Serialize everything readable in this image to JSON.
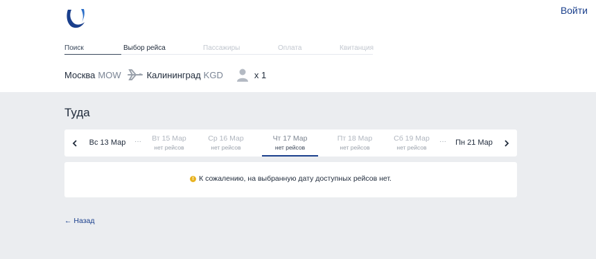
{
  "header": {
    "logo_icon": "utair-logo",
    "login_label": "Войти"
  },
  "steps": [
    {
      "label": "Поиск",
      "state": "done"
    },
    {
      "label": "Выбор рейса",
      "state": "active"
    },
    {
      "label": "Пассажиры",
      "state": "disabled"
    },
    {
      "label": "Оплата",
      "state": "disabled"
    },
    {
      "label": "Квитанция",
      "state": "disabled"
    }
  ],
  "route": {
    "from_city": "Москва",
    "from_code": "MOW",
    "to_city": "Калининград",
    "to_code": "KGD",
    "passengers": "x 1",
    "plane_icon": "plane-icon",
    "passenger_icon": "person-icon"
  },
  "section_title": "Туда",
  "dates": {
    "prev_icon": "chevron-left-icon",
    "next_icon": "chevron-right-icon",
    "first": "Вс 13 Мар",
    "last": "Пн 21 Мар",
    "dots": "···",
    "days": [
      {
        "label": "Вт 15 Мар",
        "sub": "нет рейсов",
        "selected": false
      },
      {
        "label": "Ср 16 Мар",
        "sub": "нет рейсов",
        "selected": false
      },
      {
        "label": "Чт 17 Мар",
        "sub": "нет рейсов",
        "selected": true
      },
      {
        "label": "Пт 18 Мар",
        "sub": "нет рейсов",
        "selected": false
      },
      {
        "label": "Сб 19 Мар",
        "sub": "нет рейсов",
        "selected": false
      }
    ]
  },
  "notice": {
    "icon": "warning-icon",
    "icon_glyph": "!",
    "text": "К сожалению, на выбранную дату доступных рейсов нет."
  },
  "back_label": "← Назад",
  "colors": {
    "brand": "#1a3f8c",
    "background_gray": "#ebedf0",
    "warning": "#e8b321"
  }
}
